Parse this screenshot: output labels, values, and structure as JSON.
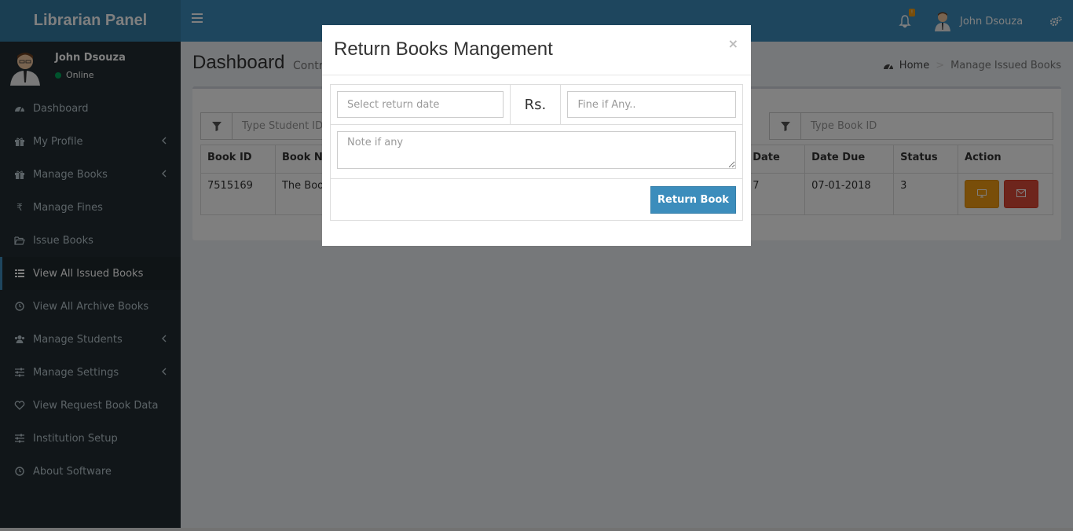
{
  "header": {
    "logo": "Librarian Panel",
    "notification_badge": "!",
    "user_name": "John Dsouza"
  },
  "sidebar": {
    "user": {
      "name": "John Dsouza",
      "status": "Online"
    },
    "items": [
      {
        "label": "Dashboard",
        "icon": "dashboard-icon"
      },
      {
        "label": "My Profile",
        "icon": "gift-icon"
      },
      {
        "label": "Manage Books",
        "icon": "gift-icon"
      },
      {
        "label": "Manage Fines",
        "icon": "rupee-icon"
      },
      {
        "label": "Issue Books",
        "icon": "folder-open-icon"
      },
      {
        "label": "View All Issued Books",
        "icon": "list-icon"
      },
      {
        "label": "View All Archive Books",
        "icon": "clock-icon"
      },
      {
        "label": "Manage Students",
        "icon": "users-icon"
      },
      {
        "label": "Manage Settings",
        "icon": "sliders-icon"
      },
      {
        "label": "View Request Book Data",
        "icon": "heart-icon"
      },
      {
        "label": "Institution Setup",
        "icon": "sliders-icon"
      },
      {
        "label": "About Software",
        "icon": "clock-icon"
      }
    ]
  },
  "content": {
    "title": "Dashboard",
    "subtitle": "Contr",
    "breadcrumb": {
      "home": "Home",
      "current": "Manage Issued Books"
    },
    "filters": {
      "student_placeholder": "Type Student ID",
      "book_placeholder": "Type Book ID"
    },
    "table": {
      "headers": [
        "Book ID",
        "Book N",
        "Date",
        "Date Due",
        "Status",
        "Action"
      ],
      "rows": [
        {
          "book_id": "7515169",
          "book_name": "The Boo",
          "date": "7",
          "date_due": "07-01-2018",
          "status": "3"
        }
      ]
    }
  },
  "modal": {
    "title": "Return Books Mangement",
    "close": "×",
    "return_date_placeholder": "Select return date",
    "currency": "Rs.",
    "fine_placeholder": "Fine if Any..",
    "note_placeholder": "Note if any",
    "submit_label": "Return Book"
  },
  "colors": {
    "primary": "#3c8dbc",
    "sidebar": "#222d32",
    "warning": "#f39c12",
    "danger": "#dd4b39"
  }
}
